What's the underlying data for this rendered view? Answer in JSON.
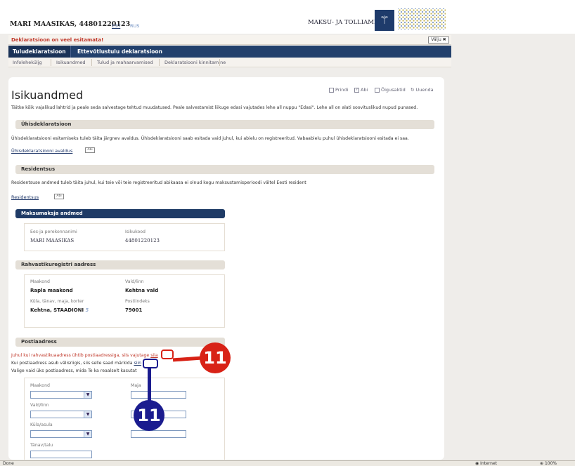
{
  "header": {
    "user": "MARI MAASIKAS, 44801220123",
    "lang_est": "EST",
    "lang_rus": "RUS",
    "agency": "MAKSU- JA TOLLIAMET"
  },
  "warning": {
    "message": "Deklaratsioon on veel esitamata!",
    "exit_label": "Välju"
  },
  "main_tabs": [
    "Tuludeklaratsioon",
    "Ettevõtlustulu deklaratsioon"
  ],
  "sub_nav": [
    "Infoleheküljg",
    "Isikuandmed",
    "Tulud ja mahaarvamised",
    "Deklaratsiooni kinnitamine"
  ],
  "page": {
    "title": "Isikuandmed",
    "tools": [
      "Prindi",
      "Abi",
      "Õigusaktid",
      "Uuenda"
    ],
    "intro": "Täitke kõik vajalikud lahtrid ja peale seda salvestage tehtud muudatused. Peale salvestamist liikuge edasi vajutades lehe all nuppu \"Edasi\". Lehe all on alati soovituslikud nupud punased."
  },
  "joint": {
    "title": "Ühisdeklaratsioon",
    "text": "Ühisdeklaratsiooni esitamiseks tuleb täita järgnev avaldus. Ühisdeklaratsiooni saab esitada vaid juhul, kui abielu on registreeritud. Vabaabielu puhul ühisdeklaratsiooni esitada ei saa.",
    "link": "Ühisdeklaratsiooni avaldus",
    "help": "Abi"
  },
  "residency": {
    "title": "Residentsus",
    "text": "Residentsuse andmed tuleb täita juhul, kui teie või teie registreeritud abikaasa ei olnud kogu maksustamisperioodi vältel Eesti resident",
    "link": "Residentsus",
    "help": "Abi"
  },
  "taxpayer": {
    "title": "Maksumaksja andmed",
    "name_label": "Ees-ja perekonnanimi",
    "id_label": "Isikukood",
    "name": "MARI MAASIKAS",
    "id": "44801220123"
  },
  "registry": {
    "title": "Rahvastikuregistri aadress",
    "county_label": "Maakond",
    "parish_label": "Vald/linn",
    "county": "Rapla maakond",
    "parish": "Kehtna vald",
    "street_label": "Küla, tänav, maja, korter",
    "postal_label": "Postiindeks",
    "street": "Kehtna, STAADIONI",
    "house": "5",
    "postal": "79001"
  },
  "postal": {
    "title": "Postiaadress",
    "line1": "Juhul kui rahvastikuaadress ühtib postiaadressiga, siis vajutage",
    "line1_link": "siia",
    "line2": "Kui postiaadress asub välisriigis, siis selle saad märkida",
    "line2_link": "siin",
    "line3": "Valige vaid üks postiaadress, mida Te ka reaalselt kasutat",
    "fields": [
      "Maakond",
      "Maja",
      "Vald/linn",
      "Küla/asula",
      "Tänav/talu"
    ]
  },
  "callouts": {
    "red": "11",
    "blue": "11"
  },
  "statusbar": {
    "left": "Done",
    "zone": "Internet",
    "zoom": "100%"
  },
  "colors": {
    "navy": "#22406c",
    "red_callout": "#d82216",
    "blue_callout": "#1b1c8f"
  }
}
